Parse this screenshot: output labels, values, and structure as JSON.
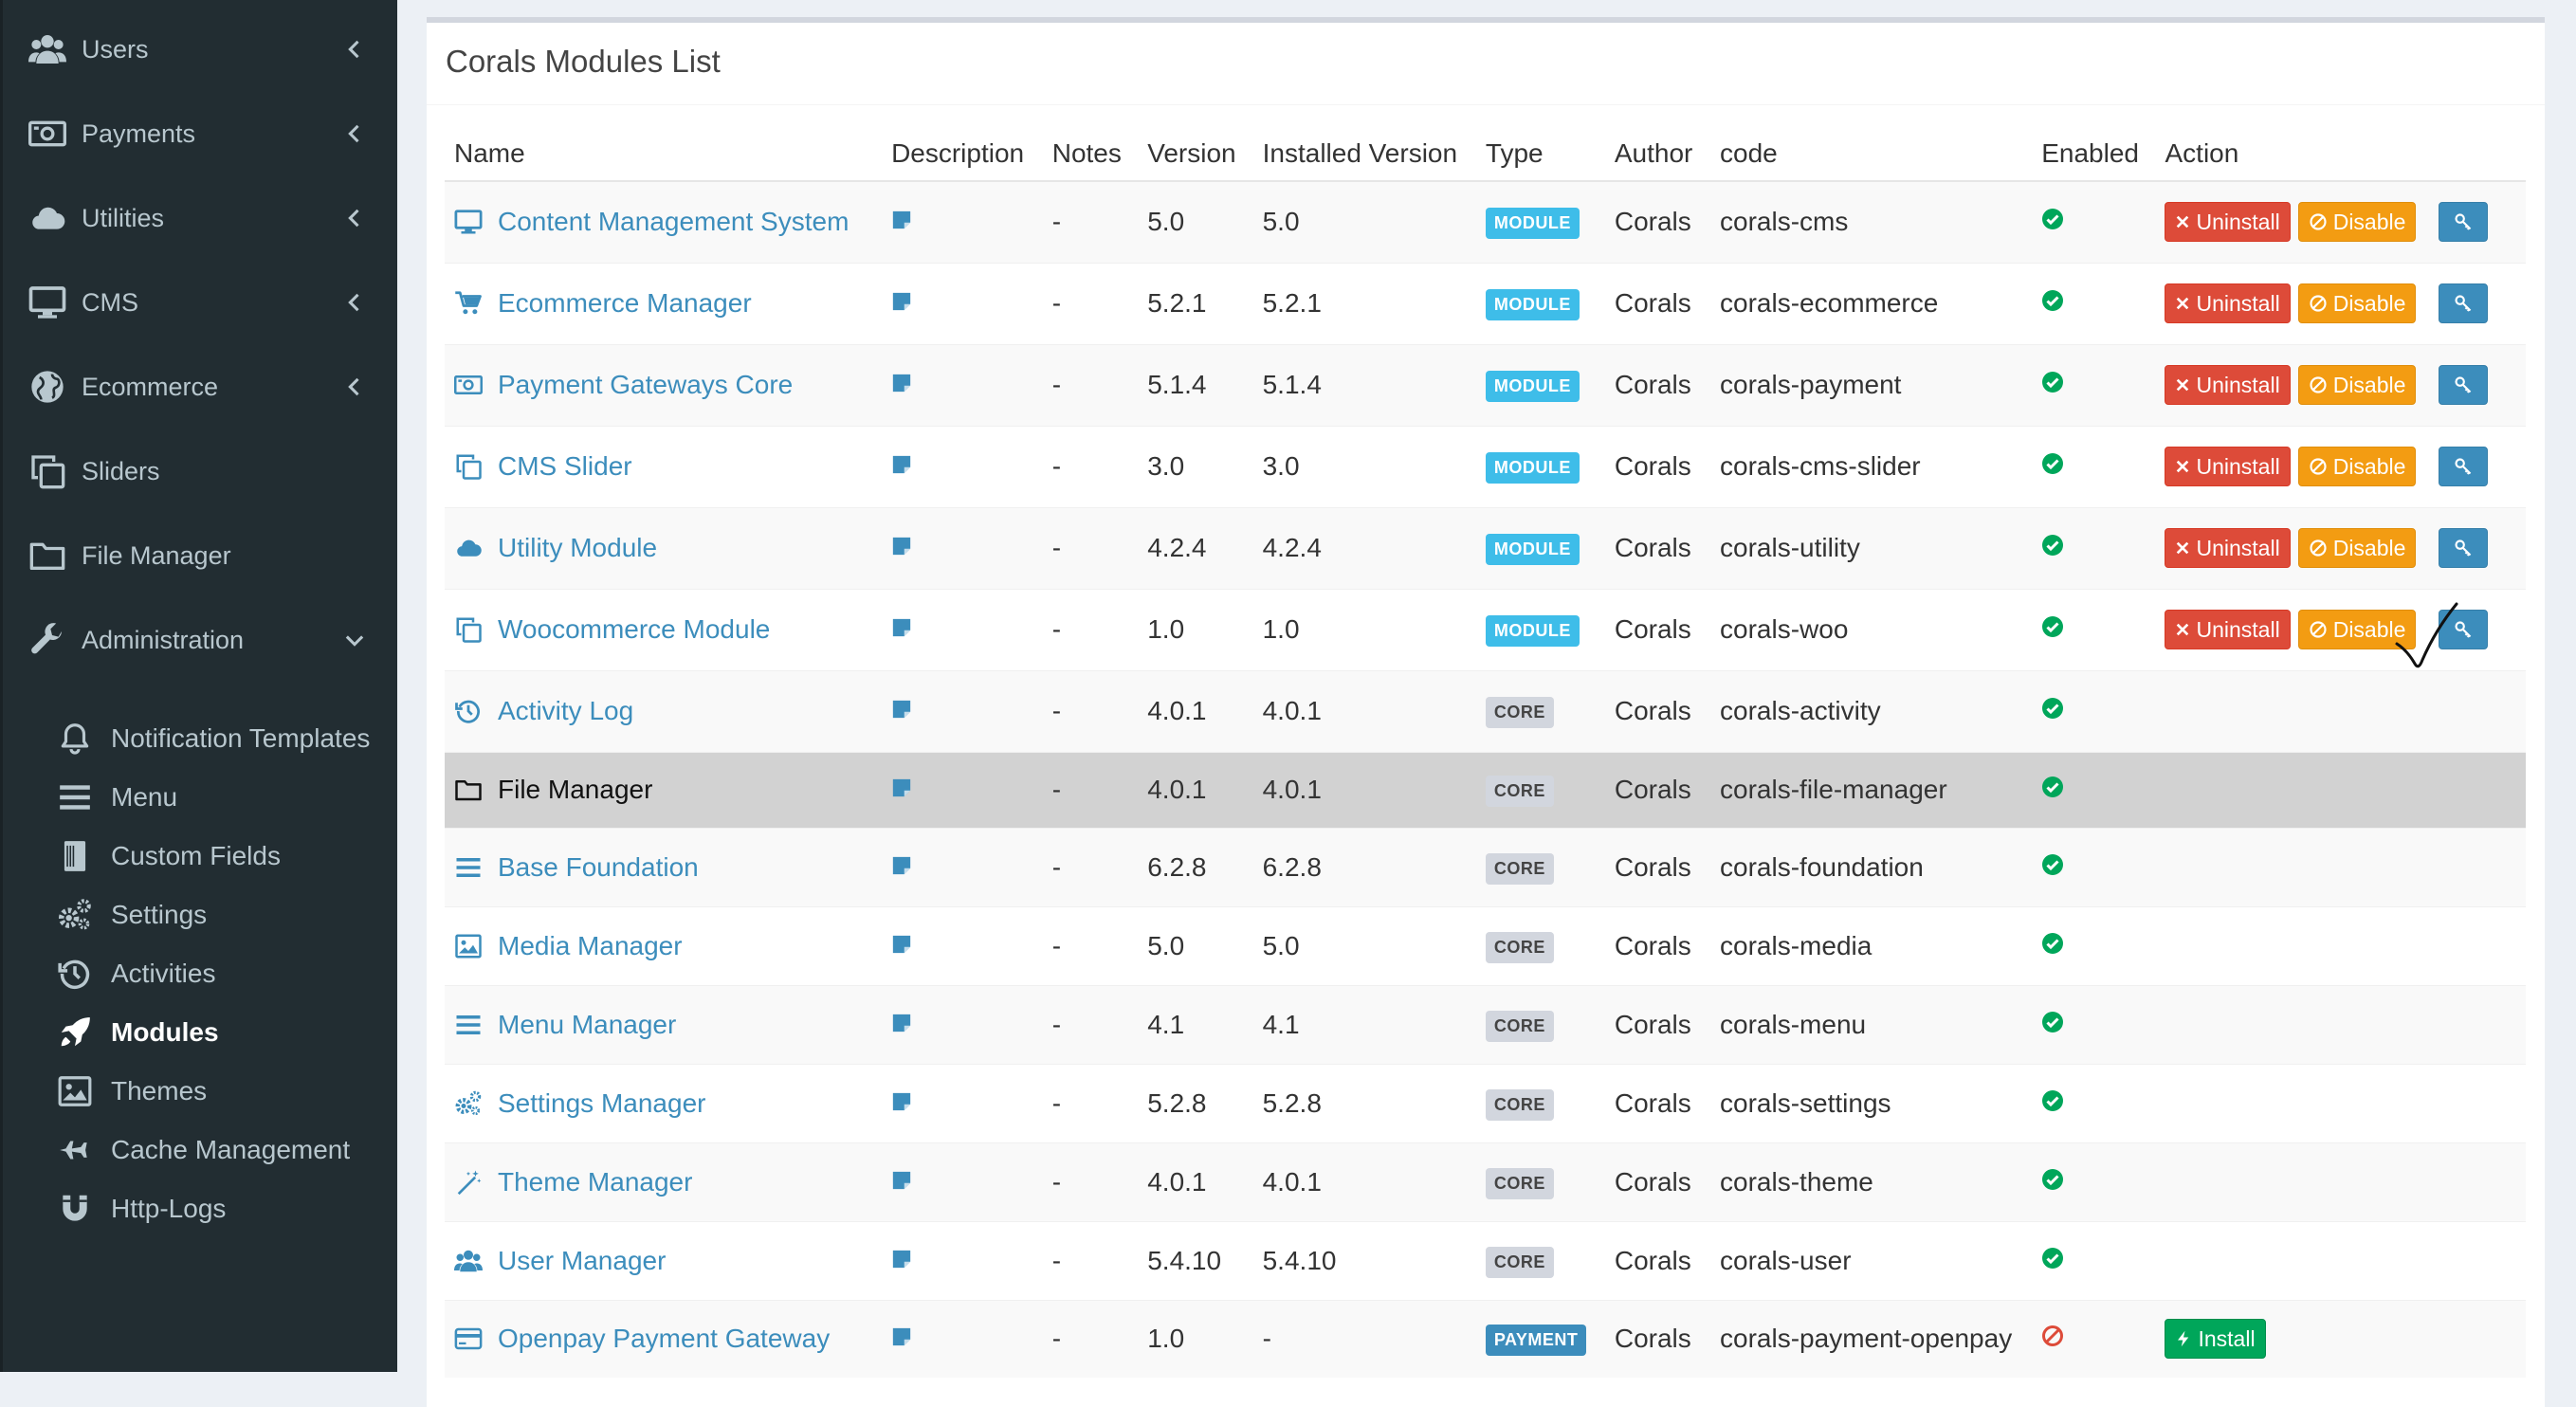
{
  "sidebar": {
    "items": [
      {
        "label": "Users",
        "icon": "users-icon",
        "chevron": "left"
      },
      {
        "label": "Payments",
        "icon": "money-icon",
        "chevron": "left"
      },
      {
        "label": "Utilities",
        "icon": "cloud-icon",
        "chevron": "left"
      },
      {
        "label": "CMS",
        "icon": "desktop-icon",
        "chevron": "left"
      },
      {
        "label": "Ecommerce",
        "icon": "globe-icon",
        "chevron": "left"
      },
      {
        "label": "Sliders",
        "icon": "clone-icon"
      },
      {
        "label": "File Manager",
        "icon": "folder-icon"
      },
      {
        "label": "Administration",
        "icon": "wrench-icon",
        "chevron": "down"
      }
    ],
    "admin_items": [
      {
        "label": "Notification Templates",
        "icon": "bell-icon"
      },
      {
        "label": "Menu",
        "icon": "bars-icon"
      },
      {
        "label": "Custom Fields",
        "icon": "book-icon"
      },
      {
        "label": "Settings",
        "icon": "cogs-icon"
      },
      {
        "label": "Activities",
        "icon": "history-icon"
      },
      {
        "label": "Modules",
        "icon": "rocket-icon",
        "active": true
      },
      {
        "label": "Themes",
        "icon": "image-icon"
      },
      {
        "label": "Cache Management",
        "icon": "plane-icon"
      },
      {
        "label": "Http-Logs",
        "icon": "magnet-icon"
      }
    ]
  },
  "page": {
    "title": "Corals Modules List"
  },
  "table": {
    "columns": [
      "Name",
      "Description",
      "Notes",
      "Version",
      "Installed Version",
      "Type",
      "Author",
      "code",
      "Enabled",
      "Action"
    ],
    "rows": [
      {
        "name": "Content Management System",
        "icon": "desktop-icon",
        "notes": "-",
        "version": "5.0",
        "installed": "5.0",
        "type": "MODULE",
        "author": "Corals",
        "code": "corals-cms",
        "enabled": true,
        "actions": [
          "Uninstall",
          "Disable"
        ]
      },
      {
        "name": "Ecommerce Manager",
        "icon": "cart-icon",
        "notes": "-",
        "version": "5.2.1",
        "installed": "5.2.1",
        "type": "MODULE",
        "author": "Corals",
        "code": "corals-ecommerce",
        "enabled": true,
        "actions": [
          "Uninstall",
          "Disable"
        ]
      },
      {
        "name": "Payment Gateways Core",
        "icon": "money-icon",
        "notes": "-",
        "version": "5.1.4",
        "installed": "5.1.4",
        "type": "MODULE",
        "author": "Corals",
        "code": "corals-payment",
        "enabled": true,
        "actions": [
          "Uninstall",
          "Disable"
        ]
      },
      {
        "name": "CMS Slider",
        "icon": "clone-icon",
        "notes": "-",
        "version": "3.0",
        "installed": "3.0",
        "type": "MODULE",
        "author": "Corals",
        "code": "corals-cms-slider",
        "enabled": true,
        "actions": [
          "Uninstall",
          "Disable"
        ]
      },
      {
        "name": "Utility Module",
        "icon": "cloud-icon",
        "notes": "-",
        "version": "4.2.4",
        "installed": "4.2.4",
        "type": "MODULE",
        "author": "Corals",
        "code": "corals-utility",
        "enabled": true,
        "actions": [
          "Uninstall",
          "Disable"
        ]
      },
      {
        "name": "Woocommerce Module",
        "icon": "clone-icon",
        "notes": "-",
        "version": "1.0",
        "installed": "1.0",
        "type": "MODULE",
        "author": "Corals",
        "code": "corals-woo",
        "enabled": true,
        "actions": [
          "Uninstall",
          "Disable"
        ]
      },
      {
        "name": "Activity Log",
        "icon": "history-icon",
        "notes": "-",
        "version": "4.0.1",
        "installed": "4.0.1",
        "type": "CORE",
        "author": "Corals",
        "code": "corals-activity",
        "enabled": true,
        "actions": []
      },
      {
        "name": "File Manager",
        "icon": "folder-icon",
        "notes": "-",
        "version": "4.0.1",
        "installed": "4.0.1",
        "type": "CORE",
        "author": "Corals",
        "code": "corals-file-manager",
        "enabled": true,
        "actions": [],
        "highlighted": true
      },
      {
        "name": "Base Foundation",
        "icon": "bars-icon",
        "notes": "-",
        "version": "6.2.8",
        "installed": "6.2.8",
        "type": "CORE",
        "author": "Corals",
        "code": "corals-foundation",
        "enabled": true,
        "actions": []
      },
      {
        "name": "Media Manager",
        "icon": "image-icon",
        "notes": "-",
        "version": "5.0",
        "installed": "5.0",
        "type": "CORE",
        "author": "Corals",
        "code": "corals-media",
        "enabled": true,
        "actions": []
      },
      {
        "name": "Menu Manager",
        "icon": "bars-icon",
        "notes": "-",
        "version": "4.1",
        "installed": "4.1",
        "type": "CORE",
        "author": "Corals",
        "code": "corals-menu",
        "enabled": true,
        "actions": []
      },
      {
        "name": "Settings Manager",
        "icon": "cogs-icon",
        "notes": "-",
        "version": "5.2.8",
        "installed": "5.2.8",
        "type": "CORE",
        "author": "Corals",
        "code": "corals-settings",
        "enabled": true,
        "actions": []
      },
      {
        "name": "Theme Manager",
        "icon": "magic-icon",
        "notes": "-",
        "version": "4.0.1",
        "installed": "4.0.1",
        "type": "CORE",
        "author": "Corals",
        "code": "corals-theme",
        "enabled": true,
        "actions": []
      },
      {
        "name": "User Manager",
        "icon": "users-icon",
        "notes": "-",
        "version": "5.4.10",
        "installed": "5.4.10",
        "type": "CORE",
        "author": "Corals",
        "code": "corals-user",
        "enabled": true,
        "actions": []
      },
      {
        "name": "Openpay Payment Gateway",
        "icon": "credit-card-icon",
        "notes": "-",
        "version": "1.0",
        "installed": "-",
        "type": "PAYMENT",
        "author": "Corals",
        "code": "corals-payment-openpay",
        "enabled": false,
        "actions": [
          "Install"
        ]
      }
    ]
  },
  "colors": {
    "sidebar_bg": "#222d32",
    "link": "#3c8dbc",
    "danger": "#dd4b39",
    "warning": "#f39c12",
    "success": "#00a65a",
    "module_badge": "#3ebde9"
  }
}
